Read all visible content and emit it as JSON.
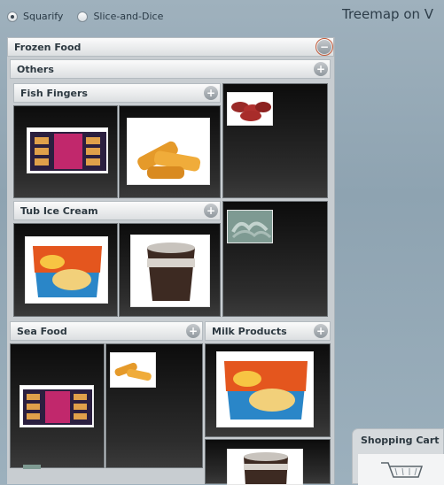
{
  "layout_options": {
    "squarify": "Squarify",
    "slice_and_dice": "Slice-and-Dice",
    "selected": "squarify"
  },
  "page_title": "Treemap on V",
  "treemap": {
    "root": "Frozen Food",
    "groups": {
      "others": "Others",
      "fish_fingers": "Fish Fingers",
      "tub_ice_cream": "Tub Ice Cream",
      "sea_food": "Sea Food",
      "milk_products": "Milk Products"
    },
    "collapse_symbol": "−",
    "expand_symbol": "+"
  },
  "cart": {
    "title": "Shopping Cart"
  },
  "product_images": {
    "fish_box_1": "fish-fingers-box",
    "fish_fingers_closeup": "fish-fingers-closeup",
    "meat_patties": "meat-patties",
    "ice_cream_tub": "ice-cream-tub",
    "ice_cream_dark_tub": "dark-ice-cream-tub",
    "prawns": "prawns",
    "seafood_box": "seafood-box",
    "fish_small": "fish-fingers-small",
    "milk_tub": "ice-cream-tub",
    "milk_dark_tub": "dark-tub",
    "partial": "product-partial"
  }
}
